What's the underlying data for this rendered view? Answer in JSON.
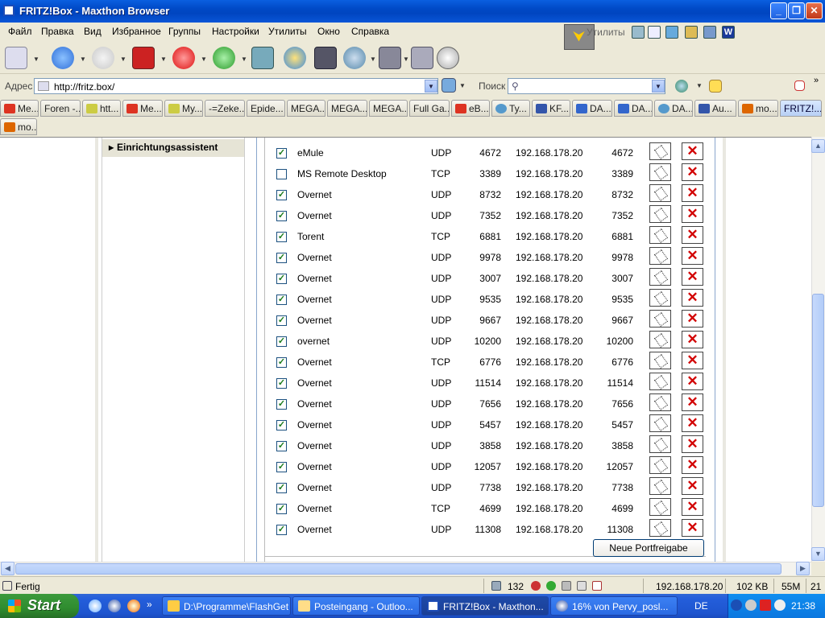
{
  "window": {
    "title": "FRITZ!Box - Maxthon Browser"
  },
  "menu": [
    "Файл",
    "Правка",
    "Вид",
    "Избранное",
    "Группы",
    "Настройки",
    "Утилиты",
    "Окно",
    "Справка"
  ],
  "utilities_label": "Утилиты",
  "address": {
    "label": "Адрес",
    "value": "http://fritz.box/"
  },
  "search": {
    "label": "Поиск",
    "placeholder": ""
  },
  "tabs_row1": [
    {
      "label": "Me...",
      "color": "#d32"
    },
    {
      "label": "Foren -...",
      "color": ""
    },
    {
      "label": "htt...",
      "color": "#cc4"
    },
    {
      "label": "Me...",
      "color": "#d32"
    },
    {
      "label": "My...",
      "color": "#cc4"
    },
    {
      "label": "-=Zeke...",
      "color": ""
    },
    {
      "label": "Epide...",
      "color": ""
    },
    {
      "label": "MEGA...",
      "color": ""
    },
    {
      "label": "MEGA...",
      "color": ""
    },
    {
      "label": "MEGA...",
      "color": ""
    },
    {
      "label": "Full Ga...",
      "color": ""
    },
    {
      "label": "eB...",
      "color": "#d32"
    },
    {
      "label": "Ty...",
      "color": "#59c"
    },
    {
      "label": "KF...",
      "color": "#35a"
    },
    {
      "label": "DA...",
      "color": "#36c"
    },
    {
      "label": "DA...",
      "color": "#36c"
    },
    {
      "label": "DA...",
      "color": "#59c"
    },
    {
      "label": "Au...",
      "color": "#35a"
    },
    {
      "label": "mo...",
      "color": "#d60"
    },
    {
      "label": "FRITZ!...",
      "color": ""
    }
  ],
  "tabs_row2": [
    {
      "label": "mo...",
      "color": "#d60"
    }
  ],
  "nav": {
    "assistant": "Einrichtungsassistent"
  },
  "rules": [
    {
      "checked": true,
      "name": "eMule",
      "protocol": "UDP",
      "port": "4672",
      "ip": "192.168.178.20",
      "port_to": "4672"
    },
    {
      "checked": false,
      "name": "MS Remote Desktop",
      "protocol": "TCP",
      "port": "3389",
      "ip": "192.168.178.20",
      "port_to": "3389"
    },
    {
      "checked": true,
      "name": "Overnet",
      "protocol": "UDP",
      "port": "8732",
      "ip": "192.168.178.20",
      "port_to": "8732"
    },
    {
      "checked": true,
      "name": "Overnet",
      "protocol": "UDP",
      "port": "7352",
      "ip": "192.168.178.20",
      "port_to": "7352"
    },
    {
      "checked": true,
      "name": "Torent",
      "protocol": "TCP",
      "port": "6881",
      "ip": "192.168.178.20",
      "port_to": "6881"
    },
    {
      "checked": true,
      "name": "Overnet",
      "protocol": "UDP",
      "port": "9978",
      "ip": "192.168.178.20",
      "port_to": "9978"
    },
    {
      "checked": true,
      "name": "Overnet",
      "protocol": "UDP",
      "port": "3007",
      "ip": "192.168.178.20",
      "port_to": "3007"
    },
    {
      "checked": true,
      "name": "Overnet",
      "protocol": "UDP",
      "port": "9535",
      "ip": "192.168.178.20",
      "port_to": "9535"
    },
    {
      "checked": true,
      "name": "Overnet",
      "protocol": "UDP",
      "port": "9667",
      "ip": "192.168.178.20",
      "port_to": "9667"
    },
    {
      "checked": true,
      "name": "overnet",
      "protocol": "UDP",
      "port": "10200",
      "ip": "192.168.178.20",
      "port_to": "10200"
    },
    {
      "checked": true,
      "name": "Overnet",
      "protocol": "TCP",
      "port": "6776",
      "ip": "192.168.178.20",
      "port_to": "6776"
    },
    {
      "checked": true,
      "name": "Overnet",
      "protocol": "UDP",
      "port": "11514",
      "ip": "192.168.178.20",
      "port_to": "11514"
    },
    {
      "checked": true,
      "name": "Overnet",
      "protocol": "UDP",
      "port": "7656",
      "ip": "192.168.178.20",
      "port_to": "7656"
    },
    {
      "checked": true,
      "name": "Overnet",
      "protocol": "UDP",
      "port": "5457",
      "ip": "192.168.178.20",
      "port_to": "5457"
    },
    {
      "checked": true,
      "name": "Overnet",
      "protocol": "UDP",
      "port": "3858",
      "ip": "192.168.178.20",
      "port_to": "3858"
    },
    {
      "checked": true,
      "name": "Overnet",
      "protocol": "UDP",
      "port": "12057",
      "ip": "192.168.178.20",
      "port_to": "12057"
    },
    {
      "checked": true,
      "name": "Overnet",
      "protocol": "UDP",
      "port": "7738",
      "ip": "192.168.178.20",
      "port_to": "7738"
    },
    {
      "checked": true,
      "name": "Overnet",
      "protocol": "TCP",
      "port": "4699",
      "ip": "192.168.178.20",
      "port_to": "4699"
    },
    {
      "checked": true,
      "name": "Overnet",
      "protocol": "UDP",
      "port": "11308",
      "ip": "192.168.178.20",
      "port_to": "11308"
    }
  ],
  "new_button": "Neue Portfreigabe",
  "status": {
    "text": "Fertig",
    "count": "132",
    "ip": "192.168.178.20",
    "size": "102 KB",
    "mem": "55M",
    "num": "21"
  },
  "taskbar": {
    "start": "Start",
    "tasks": [
      {
        "label": "D:\\Programme\\FlashGet",
        "active": false
      },
      {
        "label": "Posteingang - Outloo...",
        "active": false
      },
      {
        "label": "FRITZ!Box - Maxthon...",
        "active": true
      },
      {
        "label": "16% von Pervy_posl...",
        "active": false
      }
    ],
    "lang": "DE",
    "clock": "21:38"
  },
  "colors": {
    "title_blue": "#0049c5",
    "delete_red": "#d20000",
    "check_green": "#1a7a1a"
  }
}
